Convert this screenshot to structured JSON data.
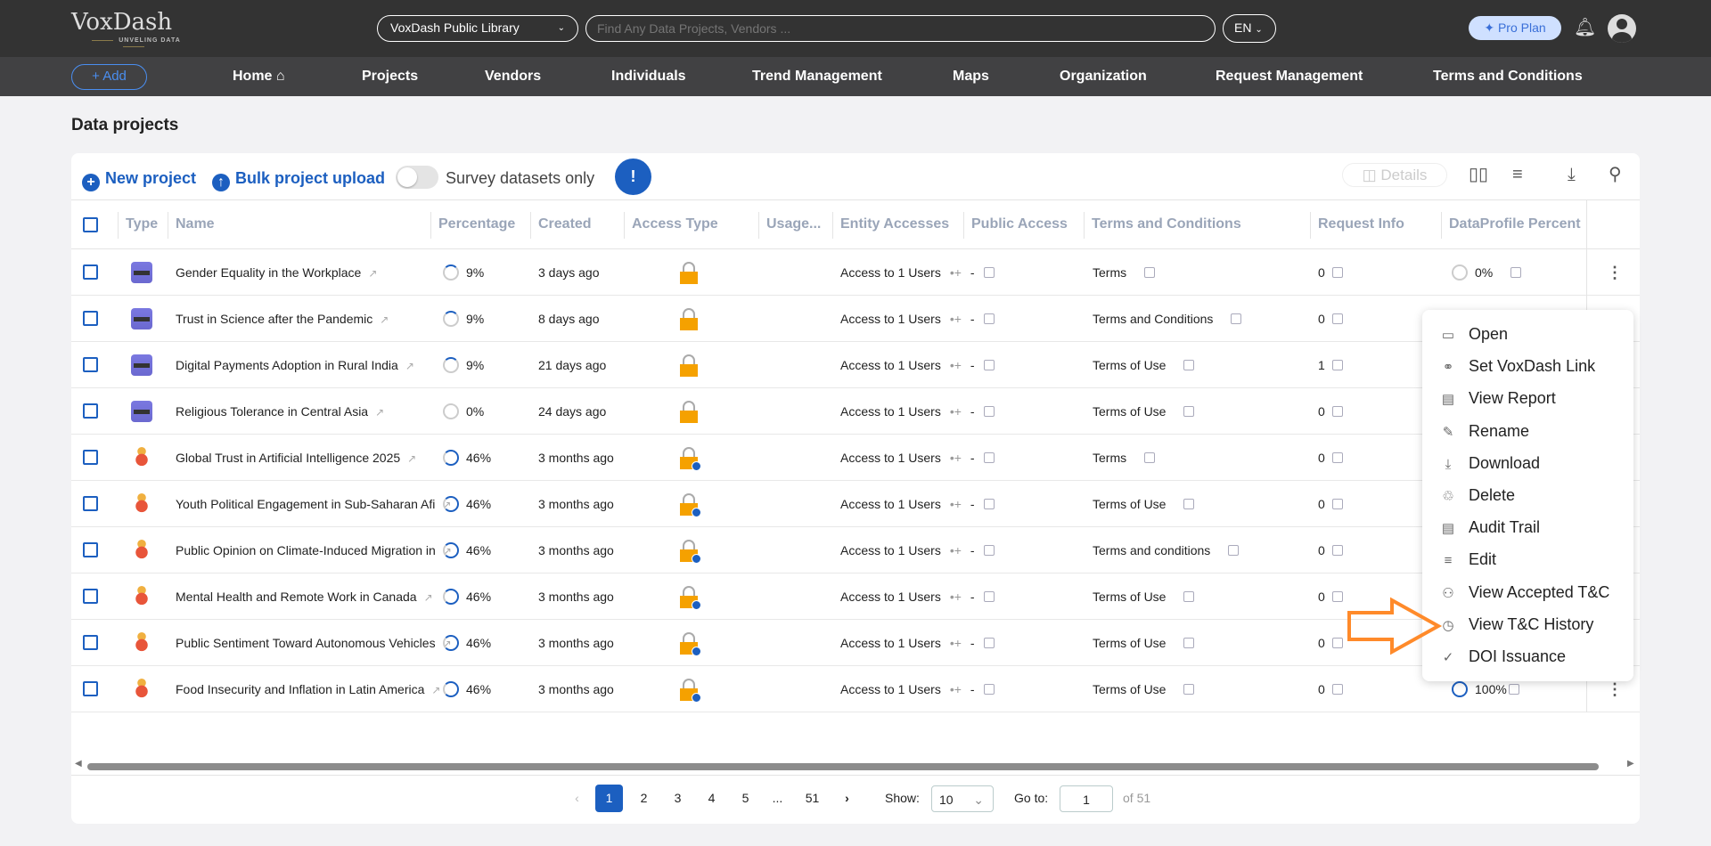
{
  "header": {
    "logo": "VoxDash",
    "logo_tagline": "UNVELING DATA",
    "library": "VoxDash Public Library",
    "search_placeholder": "Find Any Data Projects, Vendors ...",
    "language": "EN",
    "pro_plan": "Pro Plan"
  },
  "nav": {
    "add": "+ Add",
    "items": [
      "Home",
      "Projects",
      "Vendors",
      "Individuals",
      "Trend Management",
      "Maps",
      "Organization",
      "Request Management",
      "Terms and Conditions"
    ]
  },
  "page_title": "Data projects",
  "toolbar": {
    "new_project": "New project",
    "bulk_upload": "Bulk project upload",
    "survey_toggle": "Survey datasets only",
    "survey_toggle_on": false,
    "details": "Details"
  },
  "columns": [
    "Type",
    "Name",
    "Percentage",
    "Created",
    "Access Type",
    "Usage...",
    "Entity Accesses",
    "Public Access",
    "Terms and Conditions",
    "Request Info",
    "DataProfile Percent"
  ],
  "rows": [
    {
      "type": "survey",
      "name": "Gender Equality in the Workplace",
      "percentage": "9%",
      "created": "3 days ago",
      "access": "lock",
      "entity": "Access to 1 Users",
      "public": "-",
      "terms": "Terms",
      "request": "0",
      "profile": "0%"
    },
    {
      "type": "survey",
      "name": "Trust in Science after the Pandemic",
      "percentage": "9%",
      "created": "8 days ago",
      "access": "lock",
      "entity": "Access to 1 Users",
      "public": "-",
      "terms": "Terms and Conditions",
      "request": "0",
      "profile": ""
    },
    {
      "type": "survey",
      "name": "Digital Payments Adoption in Rural India",
      "percentage": "9%",
      "created": "21 days ago",
      "access": "lock",
      "entity": "Access to 1 Users",
      "public": "-",
      "terms": "Terms of Use",
      "request": "1",
      "profile": ""
    },
    {
      "type": "survey",
      "name": "Religious Tolerance in Central Asia",
      "percentage": "0%",
      "created": "24 days ago",
      "access": "lock",
      "entity": "Access to 1 Users",
      "public": "-",
      "terms": "Terms of Use",
      "request": "0",
      "profile": ""
    },
    {
      "type": "figure",
      "name": "Global Trust in Artificial Intelligence 2025",
      "percentage": "46%",
      "created": "3 months ago",
      "access": "lock-user",
      "entity": "Access to 1 Users",
      "public": "-",
      "terms": "Terms",
      "request": "0",
      "profile": ""
    },
    {
      "type": "figure",
      "name": "Youth Political Engagement in Sub-Saharan Afi",
      "percentage": "46%",
      "created": "3 months ago",
      "access": "lock-user",
      "entity": "Access to 1 Users",
      "public": "-",
      "terms": "Terms of Use",
      "request": "0",
      "profile": ""
    },
    {
      "type": "figure",
      "name": "Public Opinion on Climate-Induced Migration in",
      "percentage": "46%",
      "created": "3 months ago",
      "access": "lock-user",
      "entity": "Access to 1 Users",
      "public": "-",
      "terms": "Terms and conditions",
      "request": "0",
      "profile": ""
    },
    {
      "type": "figure",
      "name": "Mental Health and Remote Work in Canada",
      "percentage": "46%",
      "created": "3 months ago",
      "access": "lock-user",
      "entity": "Access to 1 Users",
      "public": "-",
      "terms": "Terms of Use",
      "request": "0",
      "profile": ""
    },
    {
      "type": "figure",
      "name": "Public Sentiment Toward Autonomous Vehicles",
      "percentage": "46%",
      "created": "3 months ago",
      "access": "lock-user",
      "entity": "Access to 1 Users",
      "public": "-",
      "terms": "Terms of Use",
      "request": "0",
      "profile": ""
    },
    {
      "type": "figure",
      "name": "Food Insecurity and Inflation in Latin America",
      "percentage": "46%",
      "created": "3 months ago",
      "access": "lock-user",
      "entity": "Access to 1 Users",
      "public": "-",
      "terms": "Terms of Use",
      "request": "0",
      "profile": "100%"
    }
  ],
  "context_menu": [
    {
      "label": "Open",
      "icon": "inbox-icon"
    },
    {
      "label": "Set VoxDash Link",
      "icon": "link-icon"
    },
    {
      "label": "View Report",
      "icon": "document-icon"
    },
    {
      "label": "Rename",
      "icon": "edit-icon"
    },
    {
      "label": "Download",
      "icon": "download-icon"
    },
    {
      "label": "Delete",
      "icon": "trash-icon"
    },
    {
      "label": "Audit Trail",
      "icon": "document-icon"
    },
    {
      "label": "Edit",
      "icon": "database-icon"
    },
    {
      "label": "View Accepted T&C",
      "icon": "users-icon"
    },
    {
      "label": "View T&C History",
      "icon": "clock-icon"
    },
    {
      "label": "DOI Issuance",
      "icon": "file-check-icon"
    }
  ],
  "pagination": {
    "pages": [
      "1",
      "2",
      "3",
      "4",
      "5",
      "...",
      "51"
    ],
    "current": "1",
    "show_label": "Show:",
    "show_value": "10",
    "goto_label": "Go to:",
    "goto_value": "1",
    "of_total": "of 51"
  },
  "colors": {
    "accent": "#1c5fc0",
    "lock": "#f5a100",
    "highlight_arrow": "#ff8a2a"
  }
}
